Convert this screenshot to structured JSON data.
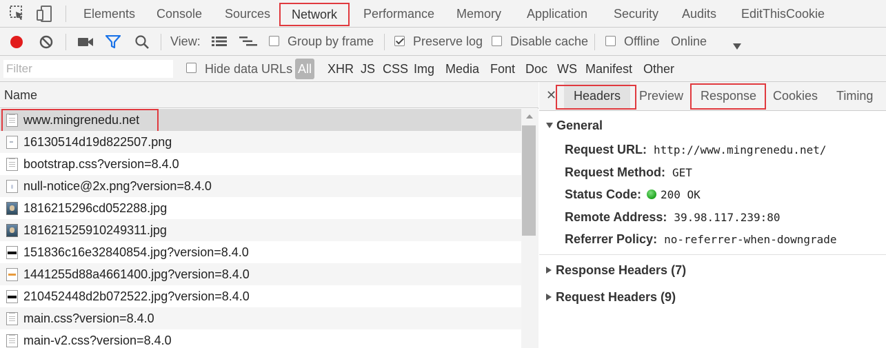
{
  "top_tabs": [
    "Elements",
    "Console",
    "Sources",
    "Network",
    "Performance",
    "Memory",
    "Application",
    "Security",
    "Audits",
    "EditThisCookie"
  ],
  "toolbar": {
    "view_label": "View:",
    "group_by_frame": "Group by frame",
    "preserve_log": "Preserve log",
    "disable_cache": "Disable cache",
    "offline": "Offline",
    "throttle": "Online"
  },
  "filterbar": {
    "placeholder": "Filter",
    "hide_data_urls": "Hide data URLs",
    "types": [
      "All",
      "XHR",
      "JS",
      "CSS",
      "Img",
      "Media",
      "Font",
      "Doc",
      "WS",
      "Manifest",
      "Other"
    ]
  },
  "list": {
    "header": "Name",
    "rows": [
      "www.mingrenedu.net",
      "16130514d19d822507.png",
      "bootstrap.css?version=8.4.0",
      "null-notice@2x.png?version=8.4.0",
      "1816215296cd052288.jpg",
      "181621525910249311.jpg",
      "151836c16e32840854.jpg?version=8.4.0",
      "1441255d88a4661400.jpg?version=8.4.0",
      "210452448d2b072522.jpg?version=8.4.0",
      "main.css?version=8.4.0",
      "main-v2.css?version=8.4.0"
    ]
  },
  "details": {
    "tabs": [
      "Headers",
      "Preview",
      "Response",
      "Cookies",
      "Timing"
    ],
    "general": {
      "title": "General",
      "request_url_key": "Request URL:",
      "request_url": "http://www.mingrenedu.net/",
      "method_key": "Request Method:",
      "method": "GET",
      "status_key": "Status Code:",
      "status": "200 OK",
      "remote_key": "Remote Address:",
      "remote": "39.98.117.239:80",
      "referrer_key": "Referrer Policy:",
      "referrer": "no-referrer-when-downgrade"
    },
    "response_headers": "Response Headers (7)",
    "request_headers": "Request Headers (9)"
  },
  "colors": {
    "highlight_red": "#e0393e",
    "record_red": "#e21d1d",
    "filter_blue": "#1a73e8",
    "status_green": "#1ea31e"
  }
}
